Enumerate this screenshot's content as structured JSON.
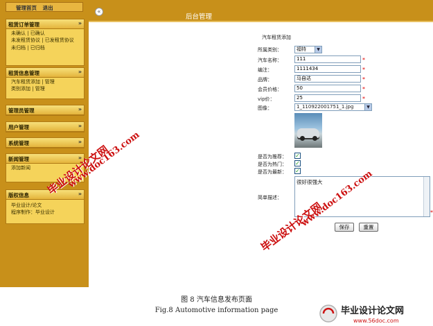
{
  "sidebar": {
    "top_links": [
      "管理首页",
      "退出"
    ],
    "panels": [
      {
        "title": "租赁订单管理",
        "items": [
          "未确认 | 已确认",
          "未发租赁协议 | 已发租赁协议",
          "未归档 | 已归档"
        ]
      },
      {
        "title": "租赁信息管理",
        "items": [
          "汽车租赁添加 | 管理",
          "类别添加 | 管理"
        ]
      },
      {
        "title": "管理员管理",
        "items": []
      },
      {
        "title": "用户管理",
        "items": []
      },
      {
        "title": "系统管理",
        "items": []
      },
      {
        "title": "新闻管理",
        "items": [
          "添加新闻"
        ]
      },
      {
        "title": "版权信息",
        "items": [
          "毕业设计/论文",
          "程序制作：毕业设计"
        ]
      }
    ]
  },
  "header": {
    "title": "后台管理",
    "collapse_icon": "«"
  },
  "form": {
    "title": "汽车租赁添加",
    "category_label": "所属类别：",
    "category_value": "福特",
    "name_label": "汽车名称：",
    "name_value": "111",
    "code_label": "编注：",
    "code_value": "1111434",
    "brand_label": "品牌：",
    "brand_value": "马自达",
    "member_price_label": "会员价格：",
    "member_price_value": "50",
    "vip_price_label": "vip价：",
    "vip_price_value": "25",
    "image_label": "图像：",
    "image_value": "1_110922001751_1.jpg",
    "recommend_label": "是否为推荐：",
    "hot_label": "是否为热门：",
    "new_label": "是否为最新：",
    "desc_label": "简单描述：",
    "desc_value": "很好很强大",
    "required_mark": "*",
    "check_mark": "✓",
    "save_label": "保存",
    "reset_label": "重置"
  },
  "watermarks": [
    "毕业设计论文网",
    "www.doc163.com"
  ],
  "captions": {
    "cn": "图 8    汽车信息发布页面",
    "en": "Fig.8 Automotive information page"
  },
  "logo": {
    "text": "毕业设计论文网",
    "url": "www.56doc.com"
  },
  "colors": {
    "sidebar": "#c8901a",
    "panel": "#f5d35a",
    "watermark": "#cc1010"
  }
}
